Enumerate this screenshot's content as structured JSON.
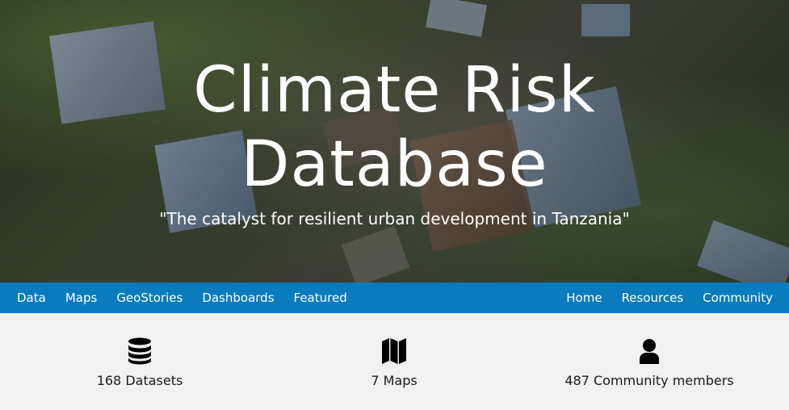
{
  "hero": {
    "title_line1": "Climate Risk",
    "title_line2": "Database",
    "tagline": "\"The catalyst for resilient urban development in Tanzania\""
  },
  "nav": {
    "left": [
      {
        "label": "Data"
      },
      {
        "label": "Maps"
      },
      {
        "label": "GeoStories"
      },
      {
        "label": "Dashboards"
      },
      {
        "label": "Featured"
      }
    ],
    "right": [
      {
        "label": "Home"
      },
      {
        "label": "Resources"
      },
      {
        "label": "Community"
      }
    ]
  },
  "stats": [
    {
      "icon": "database-icon",
      "label": "168 Datasets"
    },
    {
      "icon": "map-icon",
      "label": "7 Maps"
    },
    {
      "icon": "user-icon",
      "label": "487 Community members"
    }
  ],
  "colors": {
    "nav_background": "#0a7bbd",
    "stats_background": "#f2f1f1",
    "hero_text": "#ffffff"
  }
}
